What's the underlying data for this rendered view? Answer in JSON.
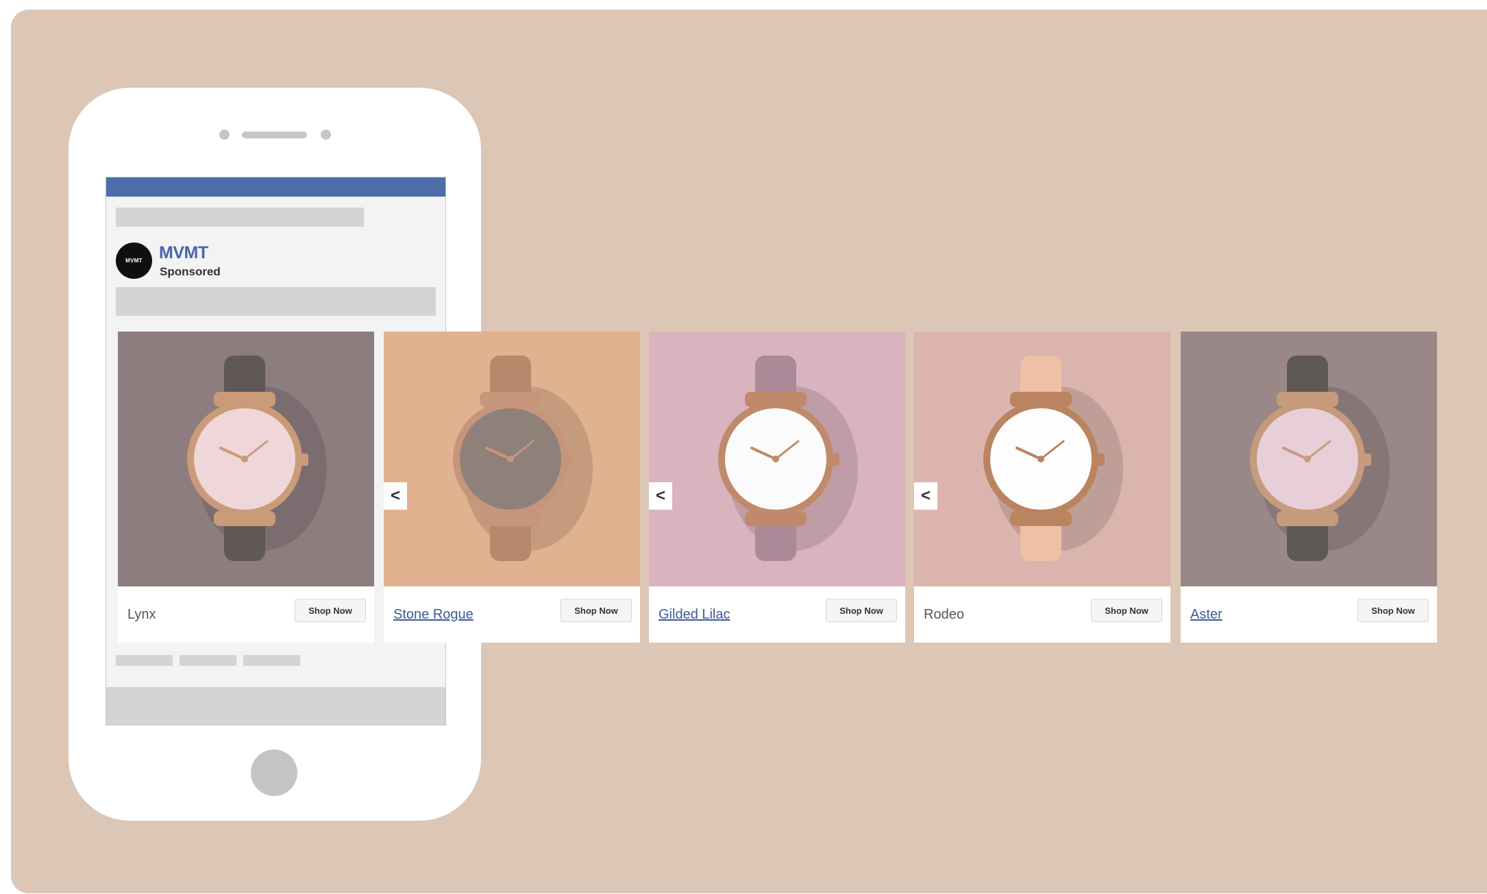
{
  "ad": {
    "brand": "MVMT",
    "avatar_text": "MVMT",
    "sponsored_label": "Sponsored"
  },
  "carousel": {
    "prev_icon": "<",
    "cards": [
      {
        "title": "Lynx",
        "cta": "Shop Now",
        "linked": false,
        "bg": "#8d7d7f",
        "face": "#efd6d9",
        "strap": "#5f5856",
        "case": "#c99b78"
      },
      {
        "title": "Stone Rogue",
        "cta": "Shop Now",
        "linked": true,
        "bg": "#e0b28f",
        "face": "#8f8179",
        "strap": "#b9876b",
        "case": "#c6957b"
      },
      {
        "title": "Gilded Lilac",
        "cta": "Shop Now",
        "linked": true,
        "bg": "#d9b3be",
        "face": "#fbfbfb",
        "strap": "#aa8a98",
        "case": "#c08a6a"
      },
      {
        "title": "Rodeo",
        "cta": "Shop Now",
        "linked": false,
        "bg": "#dbb4ae",
        "face": "#fdfdfd",
        "strap": "#f0c0a6",
        "case": "#b9845f"
      },
      {
        "title": "Aster",
        "cta": "Shop Now",
        "linked": true,
        "bg": "#9a8787",
        "face": "#e7ced9",
        "strap": "#5e5856",
        "case": "#c59b7b"
      }
    ]
  }
}
